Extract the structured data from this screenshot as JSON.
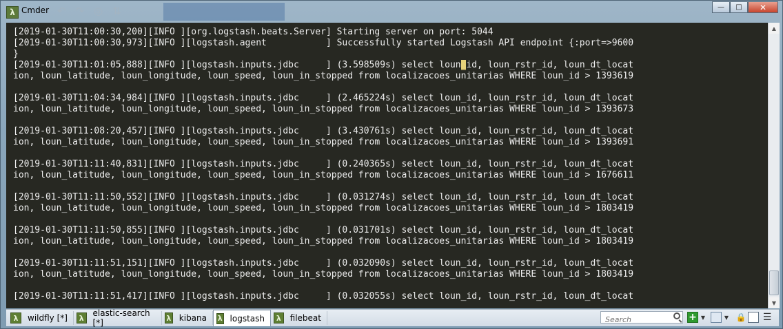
{
  "window": {
    "title": "Cmder",
    "app_icon": "lambda-icon",
    "buttons": {
      "minimize": "—",
      "maximize": "□",
      "close": "✕"
    }
  },
  "console": {
    "lines": [
      "[2019-01-30T11:00:30,200][INFO ][org.logstash.beats.Server] Starting server on port: 5044",
      "[2019-01-30T11:00:30,973][INFO ][logstash.agent           ] Successfully started Logstash API endpoint {:port=>9600",
      "}",
      "[2019-01-30T11:01:05,888][INFO ][logstash.inputs.jdbc     ] (3.598509s) select loun_id, loun_rstr_id, loun_dt_locat",
      "ion, loun_latitude, loun_longitude, loun_speed, loun_in_stopped from localizacoes_unitarias WHERE loun_id > 1393619",
      "",
      "[2019-01-30T11:04:34,984][INFO ][logstash.inputs.jdbc     ] (2.465224s) select loun_id, loun_rstr_id, loun_dt_locat",
      "ion, loun_latitude, loun_longitude, loun_speed, loun_in_stopped from localizacoes_unitarias WHERE loun_id > 1393673",
      "",
      "[2019-01-30T11:08:20,457][INFO ][logstash.inputs.jdbc     ] (3.430761s) select loun_id, loun_rstr_id, loun_dt_locat",
      "ion, loun_latitude, loun_longitude, loun_speed, loun_in_stopped from localizacoes_unitarias WHERE loun_id > 1393691",
      "",
      "[2019-01-30T11:11:40,831][INFO ][logstash.inputs.jdbc     ] (0.240365s) select loun_id, loun_rstr_id, loun_dt_locat",
      "ion, loun_latitude, loun_longitude, loun_speed, loun_in_stopped from localizacoes_unitarias WHERE loun_id > 1676611",
      "",
      "[2019-01-30T11:11:50,552][INFO ][logstash.inputs.jdbc     ] (0.031274s) select loun_id, loun_rstr_id, loun_dt_locat",
      "ion, loun_latitude, loun_longitude, loun_speed, loun_in_stopped from localizacoes_unitarias WHERE loun_id > 1803419",
      "",
      "[2019-01-30T11:11:50,855][INFO ][logstash.inputs.jdbc     ] (0.031701s) select loun_id, loun_rstr_id, loun_dt_locat",
      "ion, loun_latitude, loun_longitude, loun_speed, loun_in_stopped from localizacoes_unitarias WHERE loun_id > 1803419",
      "",
      "[2019-01-30T11:11:51,151][INFO ][logstash.inputs.jdbc     ] (0.032090s) select loun_id, loun_rstr_id, loun_dt_locat",
      "ion, loun_latitude, loun_longitude, loun_speed, loun_in_stopped from localizacoes_unitarias WHERE loun_id > 1803419",
      "",
      "[2019-01-30T11:11:51,417][INFO ][logstash.inputs.jdbc     ] (0.032055s) select loun_id, loun_rstr_id, loun_dt_locat"
    ],
    "colors": {
      "background": "#272822",
      "text": "#ededed",
      "cursor": "#e7d27a"
    }
  },
  "tabs": [
    {
      "label": "wildfly [*]",
      "icon": "lambda-icon"
    },
    {
      "label": "elastic-search [*]",
      "icon": "lambda-icon"
    },
    {
      "label": "kibana",
      "icon": "lambda-icon"
    },
    {
      "label": "logstash",
      "icon": "lambda-icon",
      "active": true
    },
    {
      "label": "filebeat",
      "icon": "lambda-icon"
    }
  ],
  "toolbar": {
    "search_placeholder": "Search",
    "add_glyph": "+",
    "dropdown_glyph": "▼",
    "lock_glyph": "🔒",
    "menu_glyph": "☰"
  }
}
